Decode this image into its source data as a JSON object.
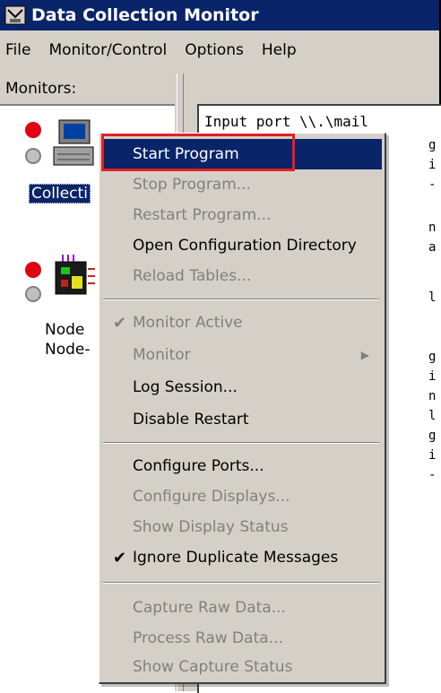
{
  "window": {
    "title": "Data Collection Monitor"
  },
  "menubar": [
    "File",
    "Monitor/Control",
    "Options",
    "Help"
  ],
  "monitors": {
    "header": "Monitors:",
    "items": [
      {
        "label": "Collecti",
        "selected": true,
        "icon": "computer-icon"
      },
      {
        "label_line1": "Node",
        "label_line2": "Node-",
        "icon": "circuit-board-icon"
      }
    ]
  },
  "console": {
    "first_line": "Input port \\\\.\\mail",
    "right_fragments": [
      "g",
      "i",
      "-",
      "n",
      "a",
      "l",
      "g",
      "i",
      "n",
      "l",
      "g",
      "i",
      "-"
    ]
  },
  "context_menu": {
    "items": [
      {
        "label": "Start Program",
        "state": "highlighted"
      },
      {
        "label": "Stop Program...",
        "state": "disabled"
      },
      {
        "label": "Restart Program...",
        "state": "disabled"
      },
      {
        "label": "Open Configuration Directory",
        "state": "enabled"
      },
      {
        "label": "Reload Tables...",
        "state": "disabled"
      },
      {
        "label": "Monitor Active",
        "state": "disabled",
        "checked": true
      },
      {
        "label": "Monitor",
        "state": "disabled",
        "submenu": true
      },
      {
        "label": "Log Session...",
        "state": "enabled"
      },
      {
        "label": "Disable Restart",
        "state": "enabled"
      },
      {
        "label": "Configure Ports...",
        "state": "enabled"
      },
      {
        "label": "Configure Displays...",
        "state": "disabled"
      },
      {
        "label": "Show Display Status",
        "state": "disabled"
      },
      {
        "label": "Ignore Duplicate Messages",
        "state": "enabled",
        "checked": true
      },
      {
        "label": "Capture Raw Data...",
        "state": "disabled"
      },
      {
        "label": "Process Raw Data...",
        "state": "disabled"
      },
      {
        "label": "Show Capture Status",
        "state": "disabled"
      }
    ],
    "checkmark": "✔",
    "submenu_arrow": "▶"
  },
  "colors": {
    "highlight": "#0a246a",
    "annotation_box": "#e02020",
    "status_red": "#e00010"
  }
}
